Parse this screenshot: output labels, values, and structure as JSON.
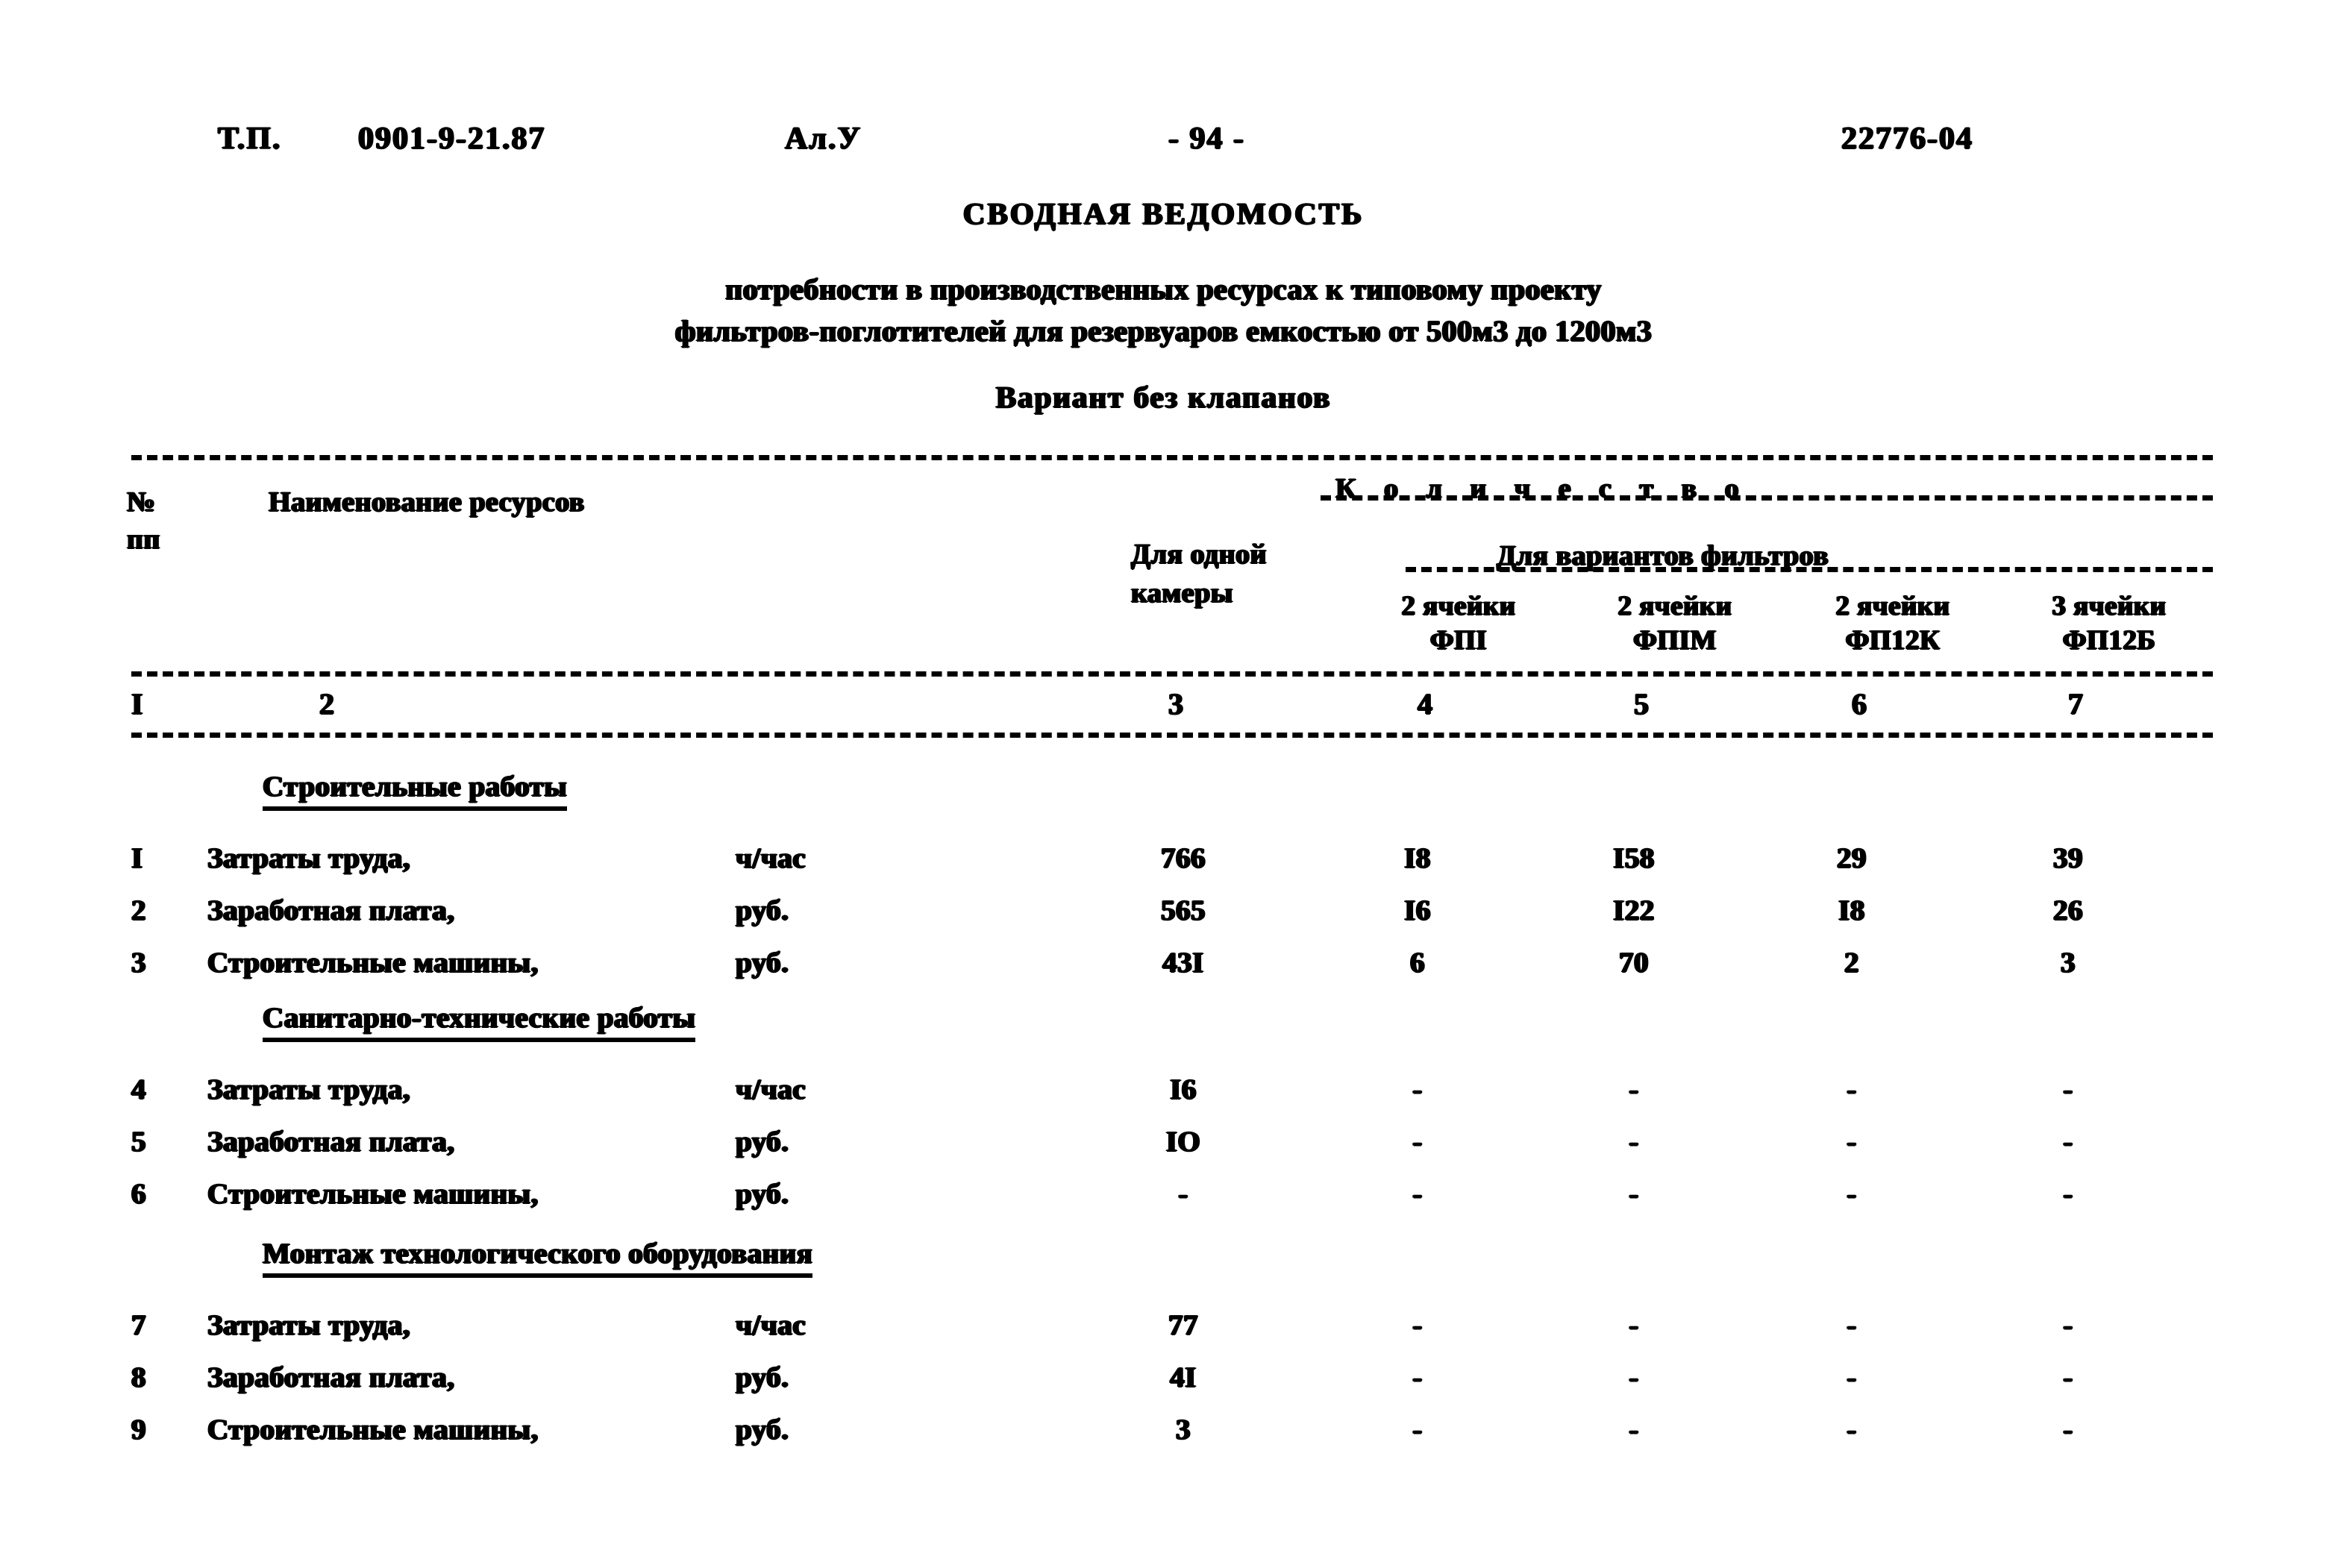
{
  "running_head": {
    "doc_type": "Т.П.",
    "project_code": "0901-9-21.87",
    "album": "Ал.У",
    "page": "- 94 -",
    "registration": "22776-04"
  },
  "title": {
    "main": "СВОДНАЯ ВЕДОМОСТЬ",
    "subtitle_line1": "потребности  в производственных ресурсах к типовому проекту",
    "subtitle_line2": "фильтров-поглотителей для резервуаров емкостью от 500м3 до 1200м3",
    "variant": "Вариант без клапанов"
  },
  "table": {
    "header": {
      "no_label_line1": "№",
      "no_label_line2": "пп",
      "name_label": "Наименование ресурсов",
      "quantity_label": "К о л и ч е с т в о",
      "single_chamber_line1": "Для одной",
      "single_chamber_line2": "камеры",
      "variants_label": "Для вариантов фильтров",
      "filter_columns": [
        {
          "cells": "2 ячейки",
          "type": "ФПI"
        },
        {
          "cells": "2 ячейки",
          "type": "ФПIМ"
        },
        {
          "cells": "2 ячейки",
          "type": "ФП12К"
        },
        {
          "cells": "3 ячейки",
          "type": "ФП12Б"
        }
      ]
    },
    "column_numbers": [
      "I",
      "2",
      "3",
      "4",
      "5",
      "6",
      "7"
    ],
    "sections": [
      {
        "heading": "Строительные работы",
        "rows": [
          {
            "no": "I",
            "name": "Затраты труда,",
            "unit": "ч/час",
            "values": [
              "766",
              "I8",
              "I58",
              "29",
              "39"
            ]
          },
          {
            "no": "2",
            "name": "Заработная плата,",
            "unit": "руб.",
            "values": [
              "565",
              "I6",
              "I22",
              "I8",
              "26"
            ]
          },
          {
            "no": "3",
            "name": "Строительные машины,",
            "unit": "руб.",
            "values": [
              "43I",
              "6",
              "70",
              "2",
              "3"
            ]
          }
        ]
      },
      {
        "heading": "Санитарно-технические работы",
        "rows": [
          {
            "no": "4",
            "name": "Затраты труда,",
            "unit": "ч/час",
            "values": [
              "I6",
              "-",
              "-",
              "-",
              "-"
            ]
          },
          {
            "no": "5",
            "name": "Заработная плата,",
            "unit": "руб.",
            "values": [
              "IO",
              "-",
              "-",
              "-",
              "-"
            ]
          },
          {
            "no": "6",
            "name": "Строительные машины,",
            "unit": "руб.",
            "values": [
              "-",
              "-",
              "-",
              "-",
              "-"
            ]
          }
        ]
      },
      {
        "heading": "Монтаж технологического оборудования",
        "rows": [
          {
            "no": "7",
            "name": "Затраты труда,",
            "unit": "ч/час",
            "values": [
              "77",
              "-",
              "-",
              "-",
              "-"
            ]
          },
          {
            "no": "8",
            "name": "Заработная плата,",
            "unit": "руб.",
            "values": [
              "4I",
              "-",
              "-",
              "-",
              "-"
            ]
          },
          {
            "no": "9",
            "name": "Строительные машины,",
            "unit": "руб.",
            "values": [
              "3",
              "-",
              "-",
              "-",
              "-"
            ]
          }
        ]
      }
    ]
  }
}
